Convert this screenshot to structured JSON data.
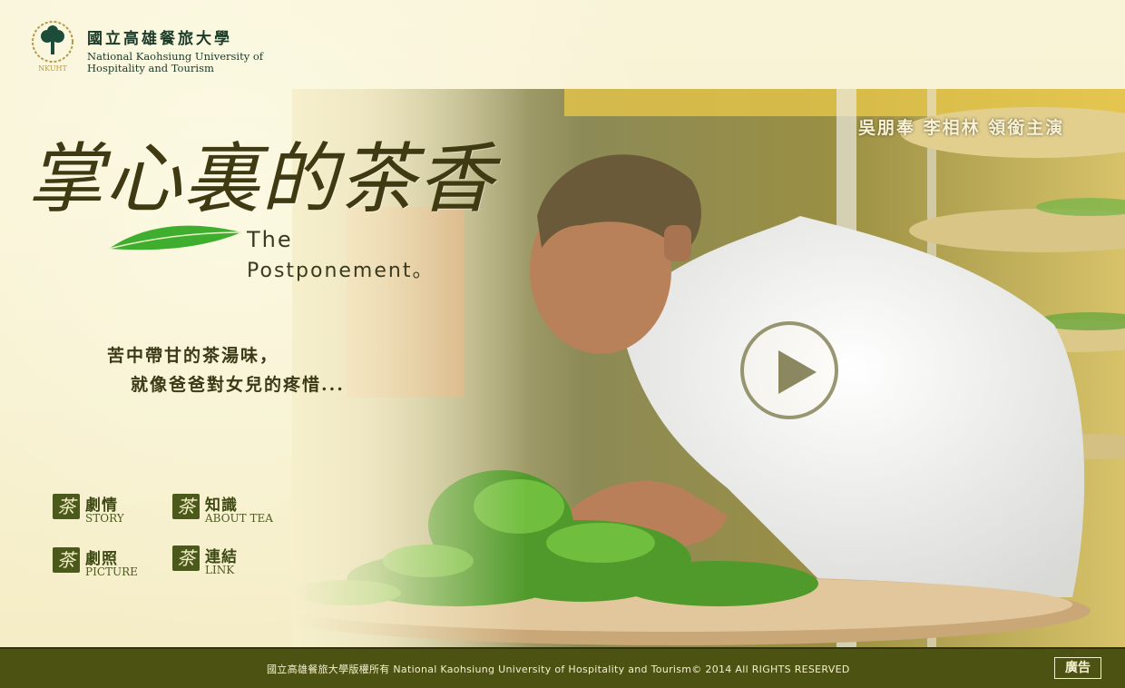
{
  "header": {
    "school_zh": "國立高雄餐旅大學",
    "school_en_line1": "National Kaohsiung University of",
    "school_en_line2": "Hospitality and Tourism",
    "emblem_text": "NKUHT"
  },
  "hero": {
    "title_zh": "掌心裏的茶香",
    "title_en_line1": "The",
    "title_en_line2": "Postponement。",
    "cast": "吳朋奉  李相林  領銜主演",
    "tagline_line1": "苦中帶甘的茶湯味，",
    "tagline_line2": "就像爸爸對女兒的疼惜..."
  },
  "nav": {
    "badge_glyph": "茶",
    "items": [
      {
        "zh": "劇情",
        "en": "STORY"
      },
      {
        "zh": "知識",
        "en": "ABOUT TEA"
      },
      {
        "zh": "劇照",
        "en": "PICTURE"
      },
      {
        "zh": "連結",
        "en": "LINK"
      }
    ]
  },
  "footer": {
    "copyright": "國立高雄餐旅大學版權所有 National Kaohsiung University of Hospitality and Tourism© 2014 All RIGHTS RESERVED",
    "ad_label": "廣告"
  },
  "colors": {
    "background": "#f7f1cf",
    "footer_bg": "#4c5312",
    "accent_green": "#4b5a1a",
    "leaf_green": "#3fae2f"
  }
}
